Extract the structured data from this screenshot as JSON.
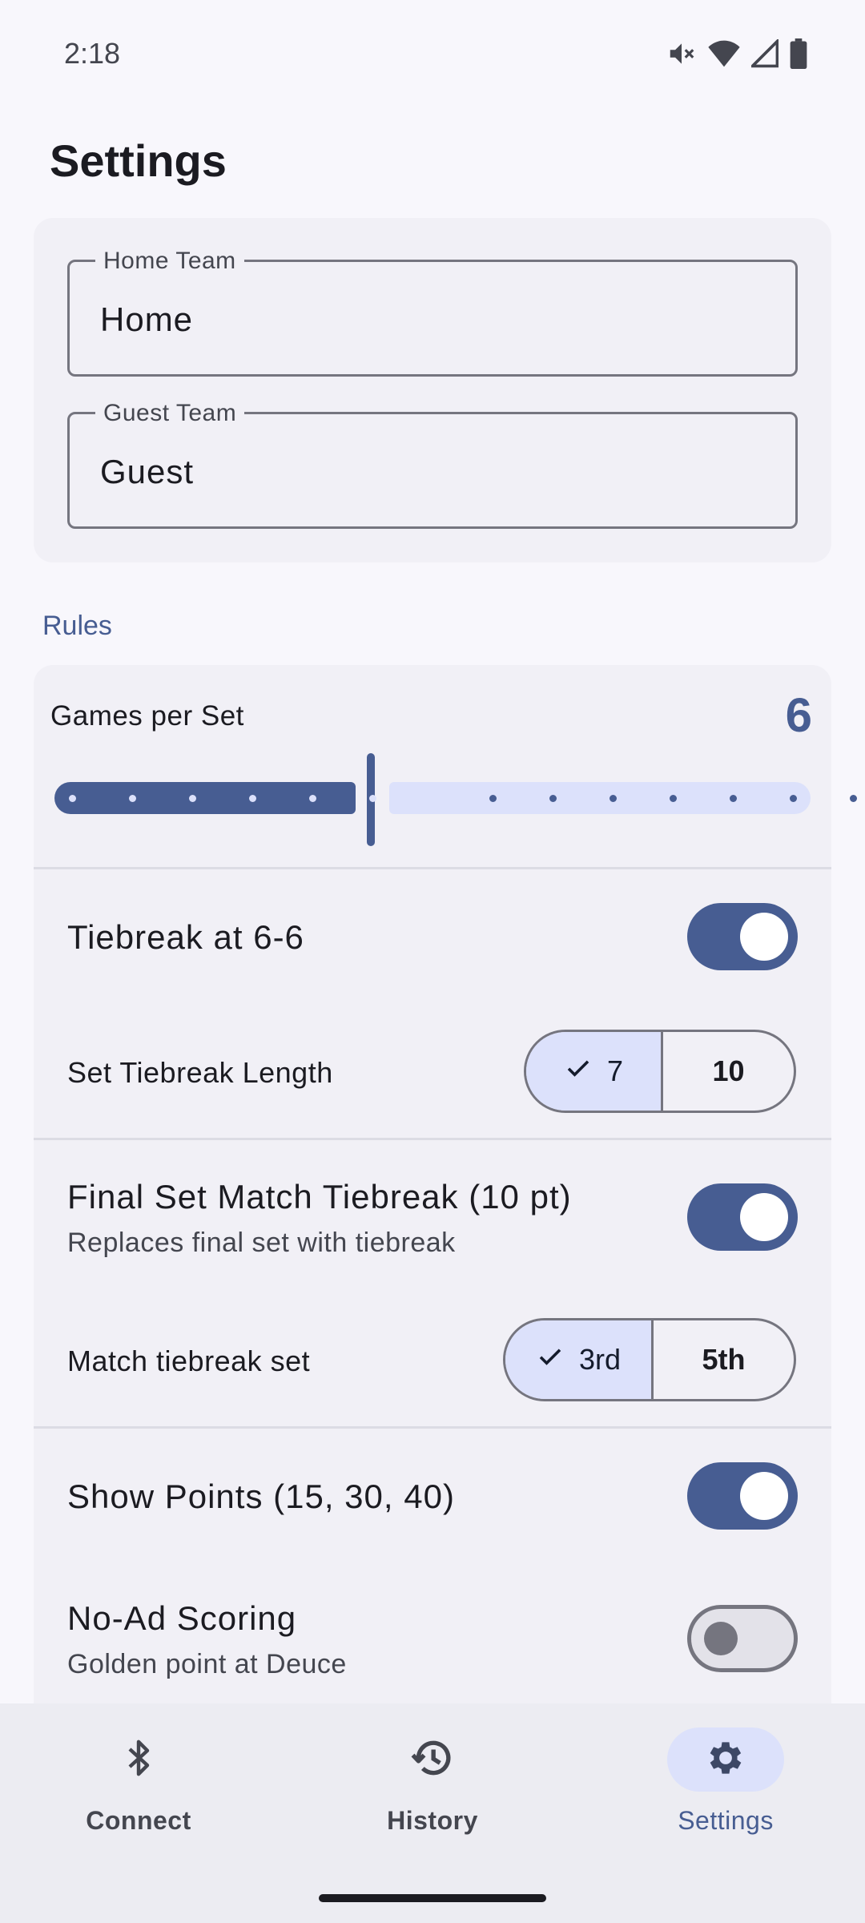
{
  "status_bar": {
    "time": "2:18",
    "icons": [
      "mute-icon",
      "wifi-icon",
      "signal-icon",
      "battery-icon"
    ]
  },
  "header": {
    "title": "Settings"
  },
  "teams": {
    "home": {
      "label": "Home Team",
      "value": "Home"
    },
    "guest": {
      "label": "Guest Team",
      "value": "Guest"
    }
  },
  "rules": {
    "section_label": "Rules",
    "games_per_set": {
      "label": "Games per Set",
      "value": "6",
      "current": 6,
      "steps": 14,
      "position_index": 6
    },
    "tiebreak": {
      "label": "Tiebreak at 6-6",
      "enabled": true
    },
    "tiebreak_length": {
      "label": "Set Tiebreak Length",
      "options": [
        "7",
        "10"
      ],
      "selected": "7"
    },
    "final_set": {
      "label": "Final Set Match Tiebreak (10 pt)",
      "description": "Replaces final set with tiebreak",
      "enabled": true
    },
    "match_tiebreak_set": {
      "label": "Match tiebreak set",
      "options": [
        "3rd",
        "5th"
      ],
      "selected": "3rd"
    },
    "show_points": {
      "label": "Show Points (15, 30, 40)",
      "enabled": true
    },
    "no_ad": {
      "label": "No-Ad Scoring",
      "description": "Golden point at Deuce",
      "enabled": false
    }
  },
  "bottom_nav": {
    "items": [
      {
        "label": "Connect",
        "icon": "bluetooth-icon",
        "active": false
      },
      {
        "label": "History",
        "icon": "history-icon",
        "active": false
      },
      {
        "label": "Settings",
        "icon": "gear-icon",
        "active": true
      }
    ]
  },
  "colors": {
    "primary": "#475d92",
    "primary_container": "#dce1fb",
    "surface": "#f8f7fc",
    "card": "#f1f0f6",
    "outline": "#75757f"
  }
}
